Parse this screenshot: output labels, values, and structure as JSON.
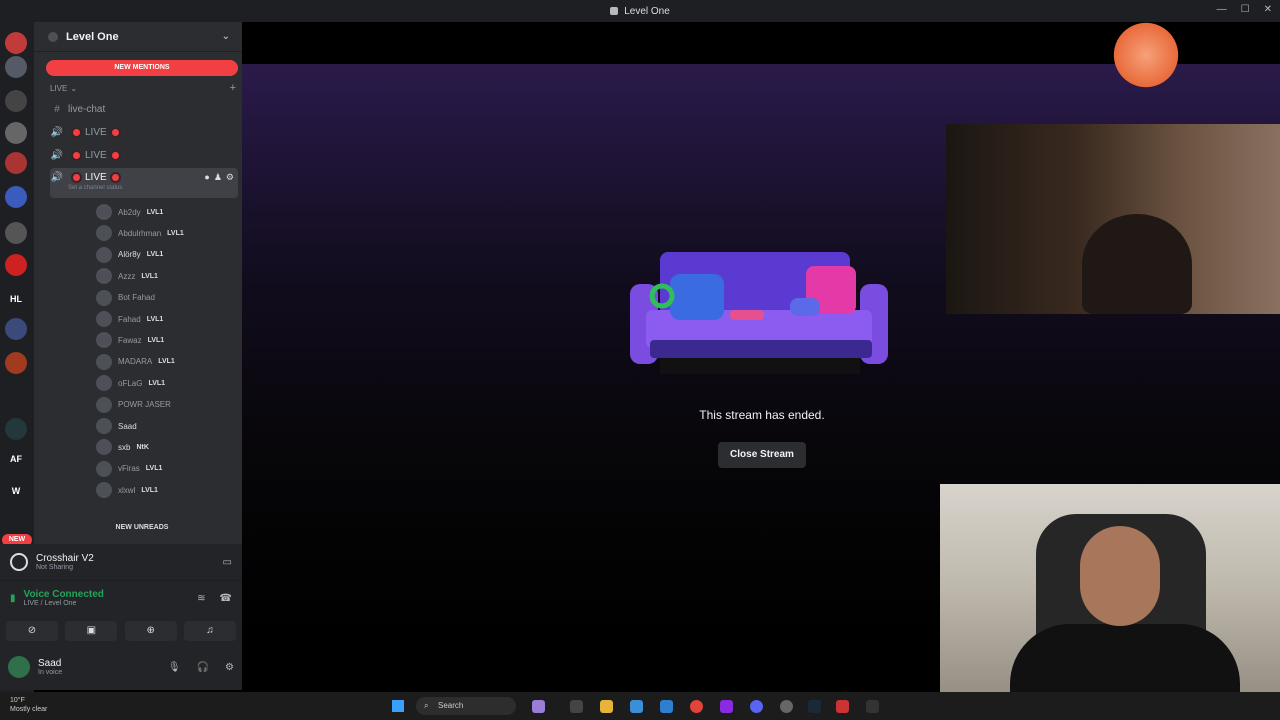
{
  "window": {
    "title": "Level One"
  },
  "server_rail": {
    "servers": [
      {
        "label": "",
        "color": "#c23b3b",
        "badge": ""
      },
      {
        "label": "",
        "color": "#555a66",
        "badge": ""
      },
      {
        "label": "",
        "color": "#444",
        "badge": ""
      },
      {
        "label": "",
        "color": "#666",
        "badge": ""
      },
      {
        "label": "",
        "color": "#a33",
        "badge": ""
      },
      {
        "label": "",
        "color": "#3b5bbd",
        "badge": ""
      },
      {
        "label": "",
        "color": "#555",
        "badge": ""
      },
      {
        "label": "",
        "color": "#c22",
        "badge": ""
      },
      {
        "label": "HL",
        "color": "#1e1f22",
        "badge": ""
      },
      {
        "label": "",
        "color": "#3a4a7a",
        "badge": ""
      },
      {
        "label": "",
        "color": "#a03b1f",
        "badge": ""
      },
      {
        "label": "",
        "color": "#1e1f22",
        "badge": ""
      },
      {
        "label": "",
        "color": "#23383a",
        "badge": ""
      },
      {
        "label": "AF",
        "color": "#1e1f22",
        "badge": ""
      },
      {
        "label": "W",
        "color": "#1e1f22",
        "badge": ""
      }
    ],
    "new_label": "NEW"
  },
  "sidebar": {
    "server_name": "Level One",
    "new_mentions": "NEW MENTIONS",
    "category": "LIVE",
    "channels": [
      {
        "name": "live-chat",
        "type": "text"
      },
      {
        "name": "LIVE",
        "type": "voice"
      },
      {
        "name": "LIVE",
        "type": "voice"
      },
      {
        "name": "LIVE",
        "type": "voice",
        "active": true,
        "status": "Set a channel status"
      }
    ],
    "members": [
      {
        "name": "Ab2dy",
        "tag": "LVL1",
        "bright": false,
        "icons": ""
      },
      {
        "name": "Abdulrhman",
        "tag": "LVL1",
        "bright": false,
        "icons": ""
      },
      {
        "name": "Alör8y",
        "tag": "LVL1",
        "bright": true,
        "icons": ""
      },
      {
        "name": "Azzz",
        "tag": "LVL1",
        "bright": false,
        "icons": ""
      },
      {
        "name": "Bot Fahad",
        "tag": "",
        "bright": false,
        "icons": "⊘ ⊘"
      },
      {
        "name": "Fahad",
        "tag": "LVL1",
        "bright": false,
        "icons": ""
      },
      {
        "name": "Fawaz",
        "tag": "LVL1",
        "bright": false,
        "icons": "⊘ ⊘"
      },
      {
        "name": "MADARA",
        "tag": "LVL1",
        "bright": false,
        "icons": ""
      },
      {
        "name": "oFLaG",
        "tag": "LVL1",
        "bright": false,
        "icons": ""
      },
      {
        "name": "POWR JASER",
        "tag": "",
        "bright": false,
        "icons": ""
      },
      {
        "name": "Saad",
        "tag": "",
        "bright": true,
        "icons": ""
      },
      {
        "name": "sxb",
        "tag": "NtK",
        "bright": true,
        "icons": ""
      },
      {
        "name": "vFiras",
        "tag": "LVL1",
        "bright": false,
        "icons": ""
      },
      {
        "name": "xlxwl",
        "tag": "LVL1",
        "bright": false,
        "icons": "⊘"
      }
    ],
    "new_unreads": "NEW UNREADS"
  },
  "activity": {
    "title": "Crosshair V2",
    "subtitle": "Not Sharing"
  },
  "voice": {
    "title": "Voice Connected",
    "subtitle": "LIVE / Level One"
  },
  "user": {
    "name": "Saad",
    "status": "In voice"
  },
  "stream": {
    "ended_text": "This stream has ended.",
    "close_button": "Close Stream"
  },
  "taskbar": {
    "search_placeholder": "Search",
    "weather_temp": "10°F",
    "weather_desc": "Mostly clear"
  },
  "colors": {
    "accent_red": "#f23f43",
    "voice_green": "#23a559",
    "sidebar": "#2b2d31"
  }
}
